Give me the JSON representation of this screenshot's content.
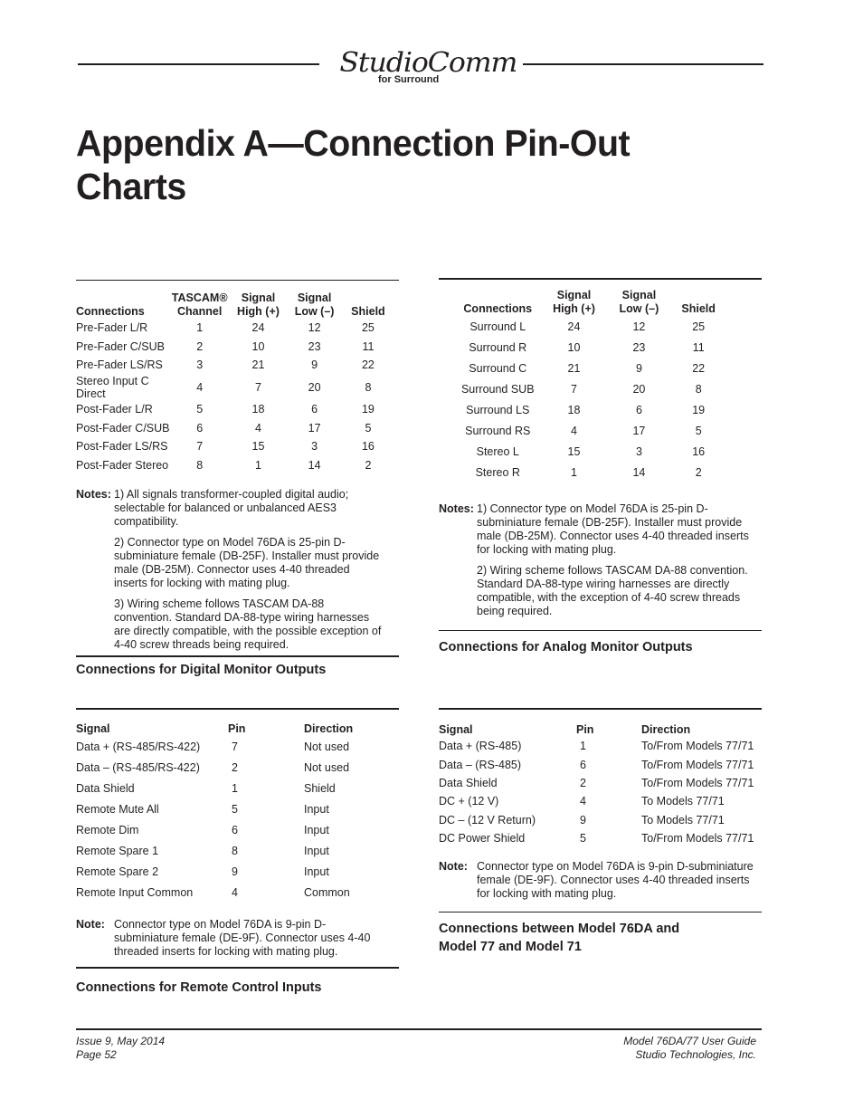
{
  "header": {
    "logo_script": "StudioComm",
    "logo_sub": "for Surround"
  },
  "title": "Appendix A—Connection Pin-Out Charts",
  "digital_monitor": {
    "caption": "Connections for Digital Monitor Outputs",
    "headers": [
      "Connections",
      "TASCAM® Channel",
      "Signal High (+)",
      "Signal Low (–)",
      "Shield"
    ],
    "headers_line1": [
      "",
      "TASCAM®",
      "Signal",
      "Signal",
      ""
    ],
    "headers_line2": [
      "Connections",
      "Channel",
      "High (+)",
      "Low (–)",
      "Shield"
    ],
    "rows": [
      [
        "Pre-Fader L/R",
        "1",
        "24",
        "12",
        "25"
      ],
      [
        "Pre-Fader C/SUB",
        "2",
        "10",
        "23",
        "11"
      ],
      [
        "Pre-Fader LS/RS",
        "3",
        "21",
        "9",
        "22"
      ],
      [
        "Stereo Input C Direct",
        "4",
        "7",
        "20",
        "8"
      ],
      [
        "Post-Fader L/R",
        "5",
        "18",
        "6",
        "19"
      ],
      [
        "Post-Fader C/SUB",
        "6",
        "4",
        "17",
        "5"
      ],
      [
        "Post-Fader LS/RS",
        "7",
        "15",
        "3",
        "16"
      ],
      [
        "Post-Fader Stereo",
        "8",
        "1",
        "14",
        "2"
      ]
    ],
    "notes_label": "Notes:",
    "notes": [
      "1) All signals transformer-coupled digital audio; selectable for balanced or unbalanced AES3 compatibility.",
      "2) Connector type on Model 76DA is 25-pin D-subminiature female (DB-25F). Installer must provide male (DB-25M). Connector uses 4-40 threaded inserts for locking with mating plug.",
      "3) Wiring scheme follows TASCAM DA-88 convention. Standard DA-88-type wiring harnesses are directly compatible, with the possible exception of 4-40 screw threads being required."
    ]
  },
  "analog_monitor": {
    "caption": "Connections for Analog Monitor Outputs",
    "headers_line1": [
      "",
      "Signal",
      "Signal",
      ""
    ],
    "headers_line2": [
      "Connections",
      "High (+)",
      "Low (–)",
      "Shield"
    ],
    "rows": [
      [
        "Surround L",
        "24",
        "12",
        "25"
      ],
      [
        "Surround R",
        "10",
        "23",
        "11"
      ],
      [
        "Surround C",
        "21",
        "9",
        "22"
      ],
      [
        "Surround SUB",
        "7",
        "20",
        "8"
      ],
      [
        "Surround LS",
        "18",
        "6",
        "19"
      ],
      [
        "Surround RS",
        "4",
        "17",
        "5"
      ],
      [
        "Stereo L",
        "15",
        "3",
        "16"
      ],
      [
        "Stereo R",
        "1",
        "14",
        "2"
      ]
    ],
    "notes_label": "Notes:",
    "notes": [
      "1) Connector type on Model 76DA is 25-pin D-subminiature female (DB-25F). Installer must provide male (DB-25M). Connector uses 4-40 threaded inserts for locking with mating plug.",
      "2) Wiring scheme follows TASCAM DA-88 convention. Standard DA-88-type wiring harnesses are directly compatible, with the exception of 4-40 screw threads being required."
    ]
  },
  "remote_control": {
    "caption": "Connections for Remote Control Inputs",
    "headers": [
      "Signal",
      "Pin",
      "Direction"
    ],
    "rows": [
      [
        "Data +  (RS-485/RS-422)",
        "7",
        "Not used"
      ],
      [
        "Data –  (RS-485/RS-422)",
        "2",
        "Not used"
      ],
      [
        "Data Shield",
        "1",
        "Shield"
      ],
      [
        "Remote Mute All",
        "5",
        "Input"
      ],
      [
        "Remote Dim",
        "6",
        "Input"
      ],
      [
        "Remote Spare 1",
        "8",
        "Input"
      ],
      [
        "Remote Spare 2",
        "9",
        "Input"
      ],
      [
        "Remote Input Common",
        "4",
        "Common"
      ]
    ],
    "note_label": "Note:",
    "note": "Connector type on Model 76DA is 9-pin D-subminiature female (DE-9F). Connector uses 4-40 threaded inserts for locking with mating plug."
  },
  "model77_71": {
    "caption": "Connections between Model 76DA and Model 77 and Model 71",
    "headers": [
      "Signal",
      "Pin",
      "Direction"
    ],
    "rows": [
      [
        "Data +  (RS-485)",
        "1",
        "To/From Models 77/71"
      ],
      [
        "Data –  (RS-485)",
        "6",
        "To/From Models 77/71"
      ],
      [
        "Data Shield",
        "2",
        "To/From Models 77/71"
      ],
      [
        "DC +  (12 V)",
        "4",
        "To Models 77/71"
      ],
      [
        "DC –  (12 V Return)",
        "9",
        "To Models 77/71"
      ],
      [
        "DC Power Shield",
        "5",
        "To/From Models 77/71"
      ]
    ],
    "note_label": "Note:",
    "note": "Connector type on Model 76DA is 9-pin D-subminiature female (DE-9F). Connector uses 4-40 threaded inserts for locking with mating plug."
  },
  "footer": {
    "issue": "Issue 9, May 2014",
    "page": "Page 52",
    "guide": "Model 76DA/77 User Guide",
    "company": "Studio Technologies, Inc."
  }
}
